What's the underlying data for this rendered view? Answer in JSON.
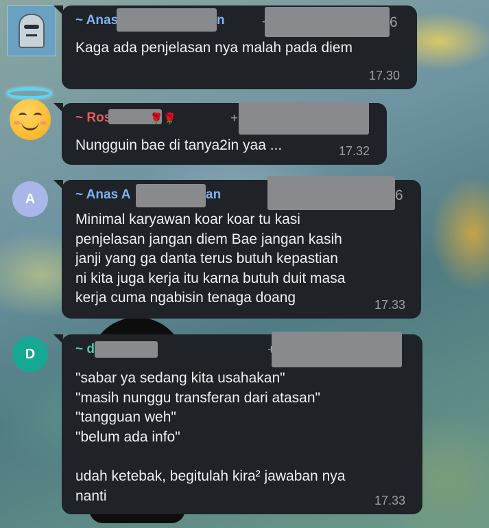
{
  "colors": {
    "bubble_bg": "#1f2226",
    "text": "#eef0f2",
    "time": "#9aa0a6",
    "sender_anas": "#7fb2f2",
    "sender_ros": "#e55f5f",
    "sender_d": "#4fc7aa",
    "avatar_a": "#aab6ea",
    "avatar_d": "#16a892"
  },
  "messages": [
    {
      "avatar": {
        "type": "image",
        "icon": "ghost-avatar-icon"
      },
      "sender": "~ Anas",
      "sender_tail": "n",
      "phone_tail": "6",
      "text": "Kaga ada penjelasan nya malah pada diem",
      "time": "17.30"
    },
    {
      "avatar": {
        "type": "emoji",
        "icon": "smiling-face-with-halo-icon"
      },
      "sender": "~ Ros",
      "sender_emoji": "🌹🌹",
      "phone_prefix": "+",
      "text": "Nungguin bae di tanya2in yaa ...",
      "time": "17.32"
    },
    {
      "avatar": {
        "type": "letter",
        "letter": "A"
      },
      "sender": "~ Anas A",
      "sender_tail": "an",
      "phone_tail": "6",
      "text": "Minimal karyawan koar koar tu kasi\npenjelasan jangan diem Bae jangan kasih\njanji yang ga danta terus butuh kepastian\nni kita juga kerja itu karna butuh duit masa\nkerja cuma ngabisin tenaga doang",
      "time": "17.33"
    },
    {
      "avatar": {
        "type": "letter",
        "letter": "D"
      },
      "sender": "~ d",
      "phone_prefix": "+",
      "text": "\"sabar ya sedang kita usahakan\"\n\"masih nunggu transferan dari atasan\"\n\"tangguan weh\"\n\"belum ada info\"\n\nudah ketebak, begitulah kira² jawaban nya\nnanti",
      "time": "17.33"
    }
  ]
}
